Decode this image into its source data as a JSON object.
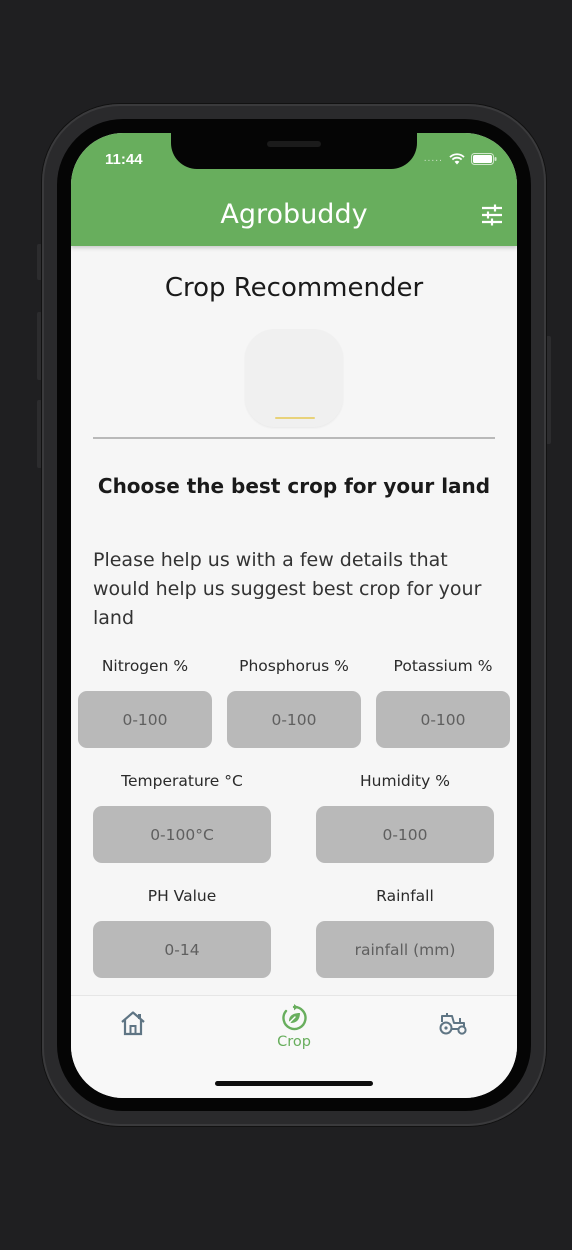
{
  "status_bar": {
    "time": "11:44",
    "signal_dots": "....."
  },
  "app_bar": {
    "title": "Agrobuddy",
    "filter_icon": "tune-icon"
  },
  "page": {
    "title": "Crop Recommender",
    "image_icon": "crop-image-placeholder",
    "subtitle": "Choose the best crop for your land",
    "description": "Please help us with a few details that would help us suggest best crop for your land"
  },
  "form": {
    "nitrogen": {
      "label": "Nitrogen %",
      "placeholder": "0-100"
    },
    "phosphorus": {
      "label": "Phosphorus %",
      "placeholder": "0-100"
    },
    "potassium": {
      "label": "Potassium %",
      "placeholder": "0-100"
    },
    "temperature": {
      "label": "Temperature °C",
      "placeholder": "0-100°C"
    },
    "humidity": {
      "label": "Humidity %",
      "placeholder": "0-100"
    },
    "ph": {
      "label": "PH Value",
      "placeholder": "0-14"
    },
    "rainfall": {
      "label": "Rainfall",
      "placeholder": "rainfall (mm)"
    }
  },
  "bottom_nav": {
    "items": [
      {
        "icon": "home-icon",
        "label": ""
      },
      {
        "icon": "crop-refresh-icon",
        "label": "Crop",
        "active": true
      },
      {
        "icon": "tractor-icon",
        "label": ""
      }
    ]
  },
  "colors": {
    "primary": "#68ae5d",
    "field_bg": "#b9b9b9",
    "background": "#f6f6f6"
  }
}
